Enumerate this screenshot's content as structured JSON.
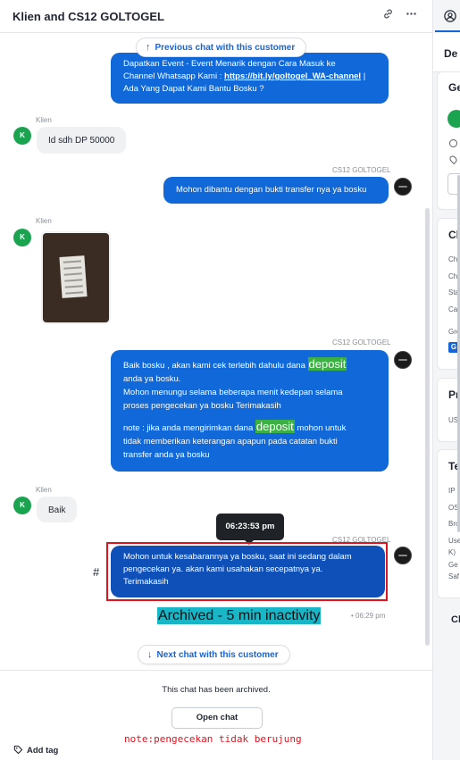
{
  "header": {
    "title": "Klien and CS12 GOLTOGEL",
    "link_icon": "link-icon",
    "more_icon": "more-icon"
  },
  "chat": {
    "previous_chat_label": "Previous chat with this customer",
    "next_chat_label": "Next chat with this customer",
    "messages": [
      {
        "sender": "agent",
        "lines": [
          "Dapatkan Event - Event Menarik dengan Cara Masuk ke",
          "Channel Whatsapp Kami : ",
          "https://bit.ly/goltogel_WA-channel",
          " | ",
          "Ada Yang Dapat Kami Bantu Bosku ?"
        ]
      },
      {
        "sender_name": "Klien",
        "avatar": "K",
        "text": "Id sdh DP 50000"
      },
      {
        "sender_name": "CS12 GOLTOGEL",
        "text": "Mohon dibantu dengan bukti transfer nya ya bosku"
      },
      {
        "sender_name": "Klien",
        "avatar": "K",
        "image": "receipt-photo"
      },
      {
        "sender_name": "CS12 GOLTOGEL",
        "parts": {
          "p1": "Baik bosku , akan kami cek terlebih dahulu dana ",
          "hl1": "deposit",
          "p2": "anda ya bosku.",
          "p3": "Mohon menungu selama beberapa menit kedepan selama",
          "p4": "proses pengecekan ya bosku Terimakasih",
          "p5": "note : jika anda mengirimkan dana ",
          "hl2": "deposit",
          "p6": " mohon untuk",
          "p7": "tidak memberikan keterangan apapun pada catatan bukti",
          "p8": "transfer anda ya bosku"
        }
      },
      {
        "sender_name": "Klien",
        "avatar": "K",
        "text": "Baik"
      },
      {
        "sender_name": "CS12 GOLTOGEL",
        "lines": [
          "Mohon untuk kesabarannya ya bosku, saat ini sedang dalam",
          "pengecekan ya. akan kami usahakan secepatnya ya.",
          "Terimakasih"
        ]
      }
    ],
    "tooltip_time": "06:23:53 pm",
    "hash_mark": "#",
    "archived_label": "Archived - 5 min inactivity",
    "archived_time": "• 06:29 pm"
  },
  "footer": {
    "archived_text": "This chat has been archived.",
    "open_chat_label": "Open chat",
    "annotation_note": "note:pengecekan tidak berujung",
    "add_tag_label": "Add tag"
  },
  "right_panel": {
    "heading_de": "De",
    "heading_ge": "Ge",
    "heading_ch": "Ch",
    "rows_ch": [
      "Ch",
      "Ch",
      "Sta",
      "Ca",
      "Gro"
    ],
    "badge_g": "G",
    "heading_pr": "Pr",
    "row_us": "US",
    "heading_te": "Te",
    "rows_te": [
      "IP a",
      "OS",
      "Bro",
      "Use",
      "K)",
      "Ge",
      "Saf"
    ],
    "heading_cl": "Cl"
  },
  "colors": {
    "agent_bubble": "#1168d8",
    "client_bubble": "#f0f1f3",
    "client_avatar": "#1ba450",
    "highlight": "#3cb043",
    "archived_highlight": "#19b6c8",
    "annotation_red": "#e0141e",
    "link_blue": "#1565d8"
  }
}
